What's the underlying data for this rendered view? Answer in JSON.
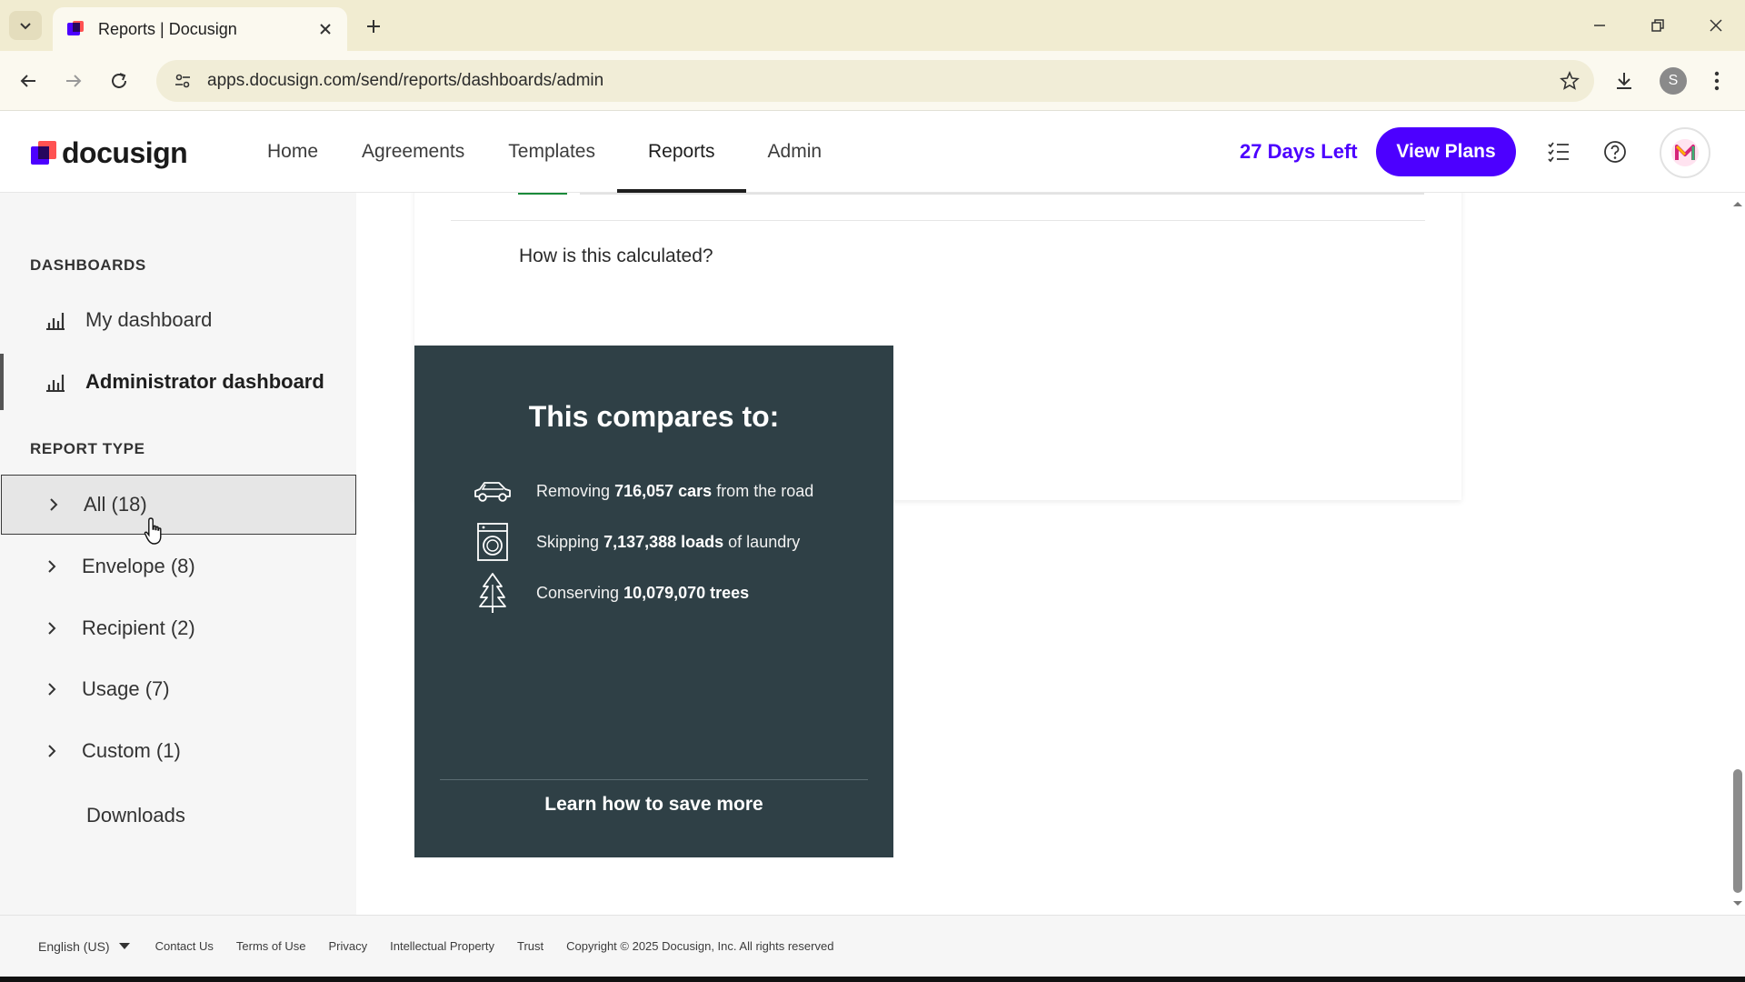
{
  "browser": {
    "tab_title": "Reports | Docusign",
    "url": "apps.docusign.com/send/reports/dashboards/admin",
    "profile_initial": "S"
  },
  "header": {
    "logo_text": "docusign",
    "nav": [
      {
        "label": "Home"
      },
      {
        "label": "Agreements"
      },
      {
        "label": "Templates"
      },
      {
        "label": "Reports",
        "active": true
      },
      {
        "label": "Admin"
      }
    ],
    "days_left": "27 Days Left",
    "view_plans": "View Plans",
    "accent_color": "#4c00ff"
  },
  "sidebar": {
    "dashboards_heading": "DASHBOARDS",
    "dashboards": [
      {
        "label": "My dashboard"
      },
      {
        "label": "Administrator dashboard",
        "active": true
      }
    ],
    "report_type_heading": "REPORT TYPE",
    "report_types": [
      {
        "label": "All (18)",
        "selected": true
      },
      {
        "label": "Envelope (8)"
      },
      {
        "label": "Recipient (2)"
      },
      {
        "label": "Usage (7)"
      },
      {
        "label": "Custom (1)"
      }
    ],
    "downloads": "Downloads"
  },
  "main": {
    "how_calculated": "How is this calculated?",
    "compare": {
      "title": "This compares to:",
      "rows": [
        {
          "icon": "car-icon",
          "prefix": "Removing",
          "value": "716,057 cars",
          "suffix": "from the road"
        },
        {
          "icon": "washing-machine-icon",
          "prefix": "Skipping",
          "value": "7,137,388 loads",
          "suffix": "of laundry"
        },
        {
          "icon": "tree-icon",
          "prefix": "Conserving",
          "value": "10,079,070 trees",
          "suffix": ""
        }
      ],
      "learn_more": "Learn how to save more",
      "card_color": "#2f4046"
    }
  },
  "footer": {
    "language": "English (US)",
    "links": [
      "Contact Us",
      "Terms of Use",
      "Privacy",
      "Intellectual Property",
      "Trust"
    ],
    "copyright": "Copyright © 2025 Docusign, Inc. All rights reserved"
  }
}
